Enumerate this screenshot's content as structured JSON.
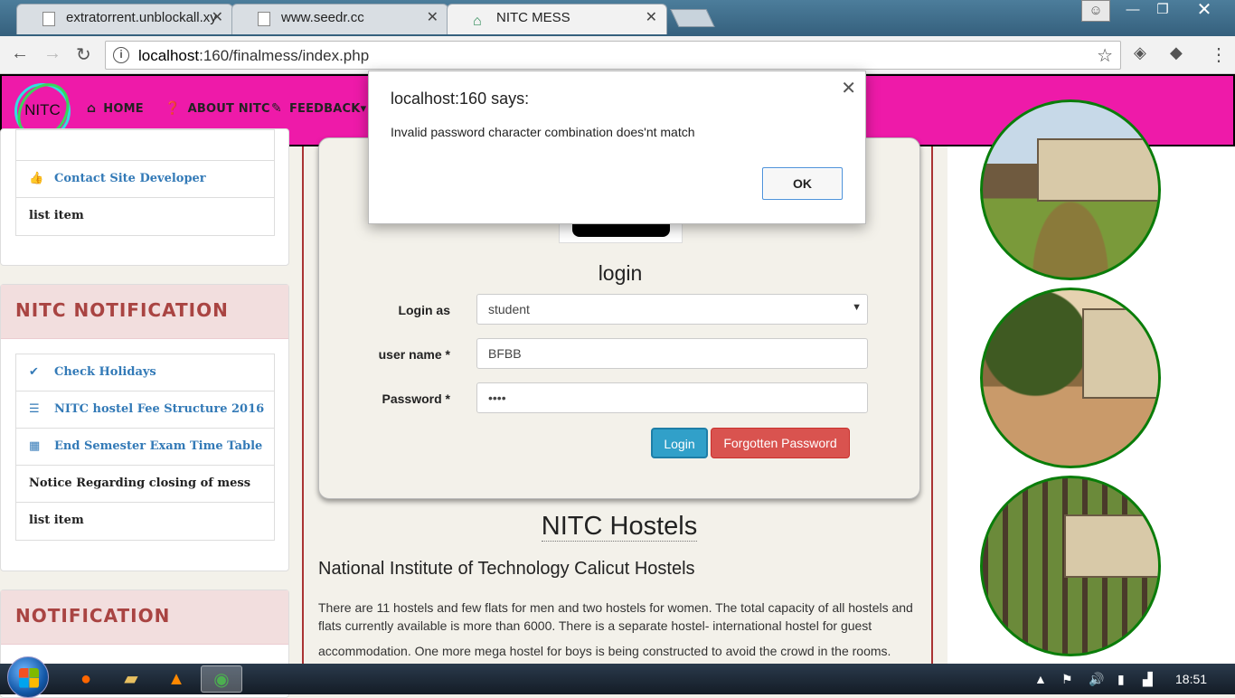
{
  "browser": {
    "tabs": [
      {
        "title": "extratorrent.unblockall.xy"
      },
      {
        "title": "www.seedr.cc"
      },
      {
        "title": "NITC MESS"
      }
    ],
    "url_host": "localhost",
    "url_rest": ":160/finalmess/index.php"
  },
  "nav": {
    "logo_text": "NITC",
    "items": [
      {
        "label": "HOME",
        "icon": "home-icon"
      },
      {
        "label": "ABOUT NITC",
        "icon": "question-circle-icon"
      },
      {
        "label": "FEEDBACK",
        "icon": "pencil-icon"
      }
    ]
  },
  "sidebar": {
    "top_list": [
      {
        "label": "Contact Site Developer",
        "icon": "thumbs-up-icon"
      },
      {
        "label": "list item"
      }
    ],
    "nitc_notification": {
      "title": "NITC NOTIFICATION",
      "items": [
        {
          "label": "Check Holidays",
          "icon": "check-icon"
        },
        {
          "label": "NITC hostel Fee Structure 2016",
          "icon": "list-icon"
        },
        {
          "label": "End Semester Exam Time Table",
          "icon": "calendar-icon"
        },
        {
          "label": "Notice Regarding closing of mess"
        },
        {
          "label": "list item"
        }
      ]
    },
    "notification": {
      "title": "NOTIFICATION"
    }
  },
  "login": {
    "title": "login",
    "login_as_label": "Login as",
    "login_as_value": "student",
    "username_label": "user name *",
    "username_value": "BFBB",
    "password_label": "Password *",
    "password_value": "••••",
    "login_button": "Login",
    "forgot_button": "Forgotten Password"
  },
  "content": {
    "heading": "NITC Hostels",
    "subheading": "National Institute of Technology Calicut Hostels",
    "paragraph": "There are 11 hostels and few flats for men and two hostels for women. The total capacity of all hostels and flats currently available is more than 6000. There is a separate hostel- international hostel for guest",
    "paragraph2": "accommodation. One more mega hostel for boys is being constructed to avoid the crowd in the rooms."
  },
  "dialog": {
    "title": "localhost:160 says:",
    "message": "Invalid password character combination does'nt match",
    "ok": "OK"
  },
  "taskbar": {
    "clock": "18:51"
  }
}
